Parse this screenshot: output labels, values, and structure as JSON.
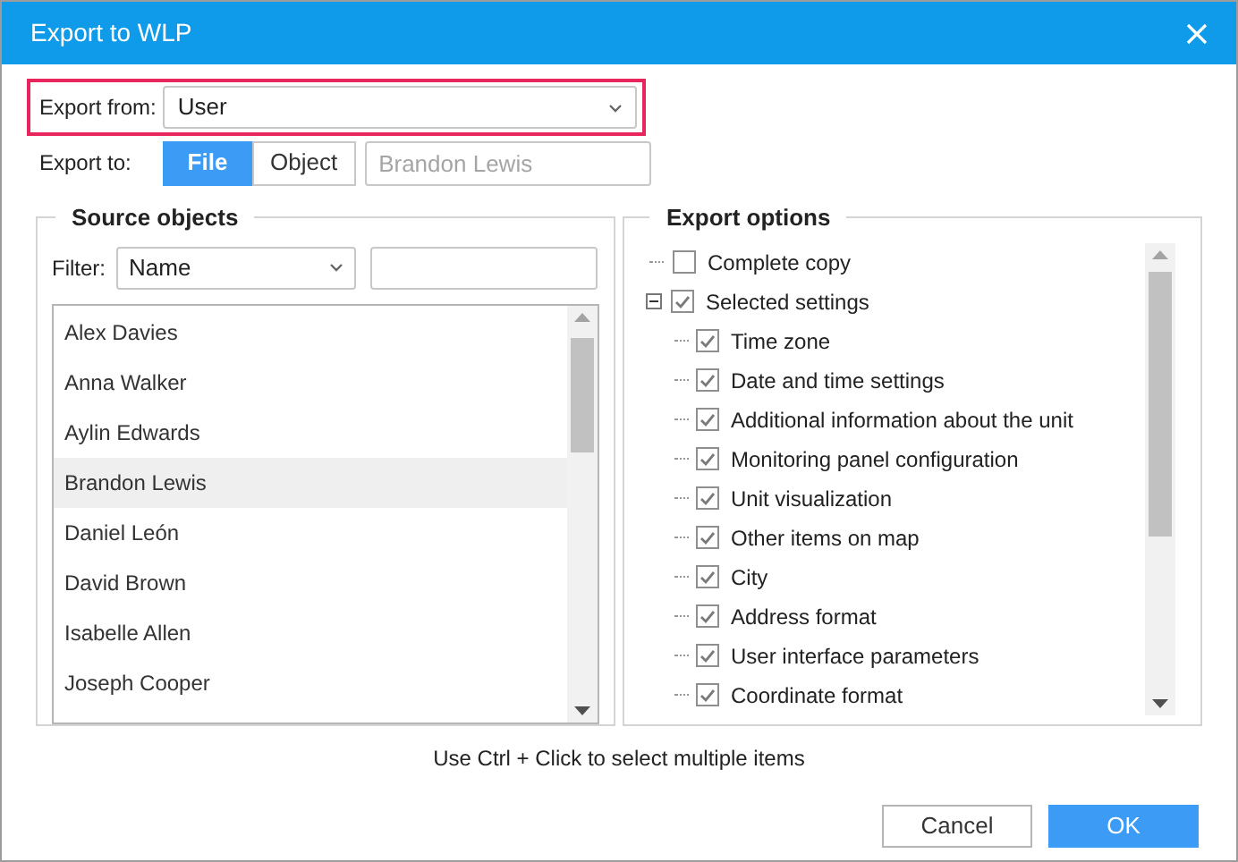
{
  "window": {
    "title": "Export to WLP"
  },
  "export_from": {
    "label": "Export from:",
    "value": "User"
  },
  "export_to": {
    "label": "Export to:",
    "tabs": [
      {
        "label": "File",
        "selected": true
      },
      {
        "label": "Object",
        "selected": false
      }
    ],
    "target": {
      "placeholder": "Brandon Lewis"
    }
  },
  "source_objects": {
    "title": "Source objects",
    "filter_label": "Filter:",
    "filter_value": "Name",
    "items": [
      {
        "name": "Alex Davies",
        "selected": false
      },
      {
        "name": "Anna Walker",
        "selected": false
      },
      {
        "name": "Aylin Edwards",
        "selected": false
      },
      {
        "name": "Brandon Lewis",
        "selected": true
      },
      {
        "name": "Daniel León",
        "selected": false
      },
      {
        "name": "David Brown",
        "selected": false
      },
      {
        "name": "Isabelle Allen",
        "selected": false
      },
      {
        "name": "Joseph Cooper",
        "selected": false
      }
    ]
  },
  "export_options": {
    "title": "Export options",
    "items": [
      {
        "label": "Complete copy",
        "checked": false
      },
      {
        "label": "Selected settings",
        "checked": true,
        "expanded": true,
        "children": [
          {
            "label": "Time zone",
            "checked": true
          },
          {
            "label": "Date and time settings",
            "checked": true
          },
          {
            "label": "Additional information about the unit",
            "checked": true
          },
          {
            "label": "Monitoring panel configuration",
            "checked": true
          },
          {
            "label": "Unit visualization",
            "checked": true
          },
          {
            "label": "Other items on map",
            "checked": true
          },
          {
            "label": "City",
            "checked": true
          },
          {
            "label": "Address format",
            "checked": true
          },
          {
            "label": "User interface parameters",
            "checked": true
          },
          {
            "label": "Coordinate format",
            "checked": true
          }
        ]
      }
    ]
  },
  "hint": "Use Ctrl + Click to select multiple items",
  "buttons": [
    {
      "label": "Cancel",
      "kind": "secondary"
    },
    {
      "label": "OK",
      "kind": "primary"
    }
  ]
}
